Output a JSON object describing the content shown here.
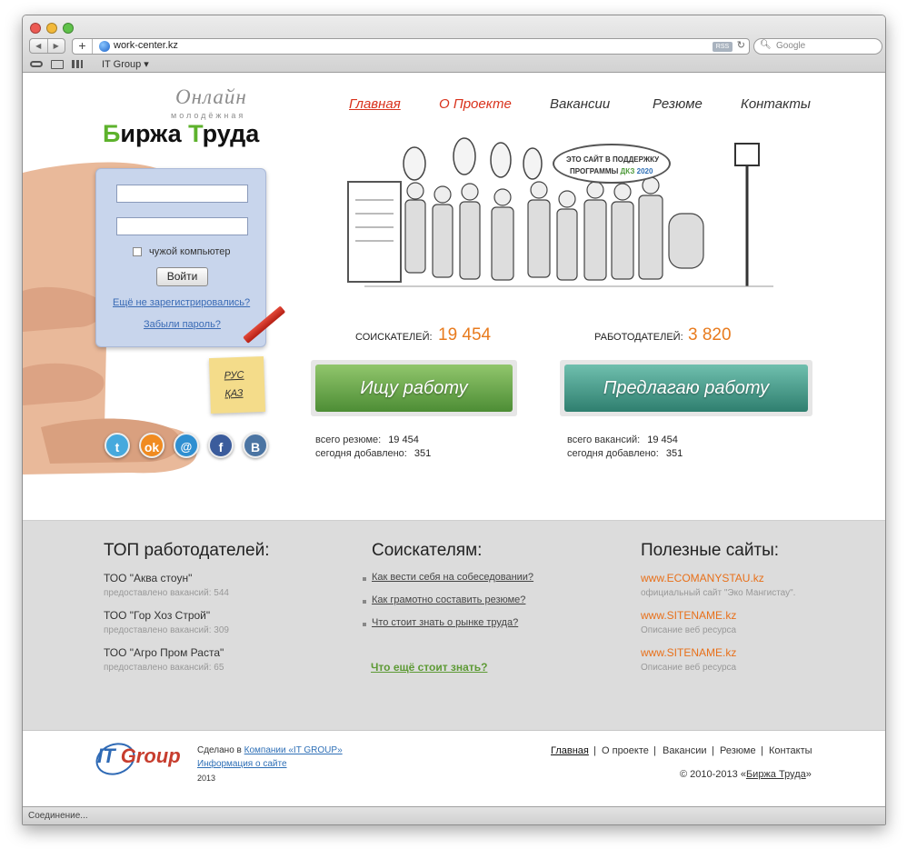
{
  "browser": {
    "url": "work-center.kz",
    "rss_label": "RSS",
    "search_placeholder": "Google",
    "bookmark_folder": "IT Group ▾",
    "status_text": "Соединение..."
  },
  "logo": {
    "line1": "Онлайн",
    "line2": "молодёжная",
    "title_part1_green": "Б",
    "title_part2": "иржа ",
    "title_part3_green": "Т",
    "title_part4": "руда"
  },
  "login": {
    "remember_label": "чужой компьютер",
    "submit_label": "Войти",
    "register_link": "Ещё не зарегистрировались?",
    "forgot_link": "Забыли пароль?"
  },
  "lang": {
    "ru": "РУС",
    "kz": "ҚАЗ"
  },
  "social": [
    "twitter",
    "odnoklassniki",
    "mail",
    "facebook",
    "vkontakte"
  ],
  "nav": [
    {
      "label": "Главная"
    },
    {
      "label": "О Проекте"
    },
    {
      "label": "Вакансии"
    },
    {
      "label": "Резюме"
    },
    {
      "label": "Контакты"
    }
  ],
  "banner": {
    "bubble_line1": "ЭТО САЙТ В ПОДДЕРЖКУ",
    "bubble_line2_a": "ПРОГРАММЫ ",
    "bubble_line2_b": "ДКЗ",
    "bubble_line2_c": " 2020"
  },
  "stats": {
    "seekers_label": "СОИСКАТЕЛЕЙ:",
    "seekers_value": "19 454",
    "employers_label": "РАБОТОДАТЕЛЕЙ:",
    "employers_value": "3 820"
  },
  "actions": {
    "find_job": "Ищу работу",
    "offer_job": "Предлагаю работу",
    "resume_total_label": "всего резюме:",
    "resume_total": "19 454",
    "resume_today_label": "сегодня добавлено:",
    "resume_today": "351",
    "vacancy_total_label": "всего вакансий:",
    "vacancy_total": "19 454",
    "vacancy_today_label": "сегодня добавлено:",
    "vacancy_today": "351"
  },
  "top_employers": {
    "heading": "ТОП работодателей:",
    "items": [
      {
        "name": "ТОО \"Аква стоун\"",
        "meta": "предоставлено вакансий: 544"
      },
      {
        "name": "ТОО \"Гор Хоз Строй\"",
        "meta": "предоставлено вакансий: 309"
      },
      {
        "name": "ТОО \"Агро Пром Раста\"",
        "meta": "предоставлено вакансий: 65"
      }
    ]
  },
  "for_seekers": {
    "heading": "Соискателям:",
    "links": [
      "Как вести себя на собеседовании?",
      "Как грамотно составить резюме?",
      "Что стоит знать о рынке труда?"
    ],
    "more": "Что ещё стоит знать?"
  },
  "useful_sites": {
    "heading": "Полезные сайты:",
    "items": [
      {
        "link": "www.ECOMANYSTAU.kz",
        "meta": "официальный сайт \"Эко Мангистау\"."
      },
      {
        "link": "www.SITENAME.kz",
        "meta": "Описание веб ресурса"
      },
      {
        "link": "www.SITENAME.kz",
        "meta": "Описание веб ресурса"
      }
    ]
  },
  "footer": {
    "logo_it": "IT",
    "logo_group": "Group",
    "made_in": "Сделано в ",
    "company_link": "Компании «IT GROUP»",
    "site_info": "Информация о сайте",
    "year": "2013",
    "nav": [
      "Главная",
      "О проекте",
      "Вакансии",
      "Резюме",
      "Контакты"
    ],
    "copyright_pre": "© 2010-2013 «",
    "copyright_link": "Биржа Труда",
    "copyright_post": "»"
  },
  "colors": {
    "accent_red": "#d9321c",
    "orange": "#e87b1e",
    "green": "#5db22c",
    "link_blue": "#2e6fb6"
  }
}
